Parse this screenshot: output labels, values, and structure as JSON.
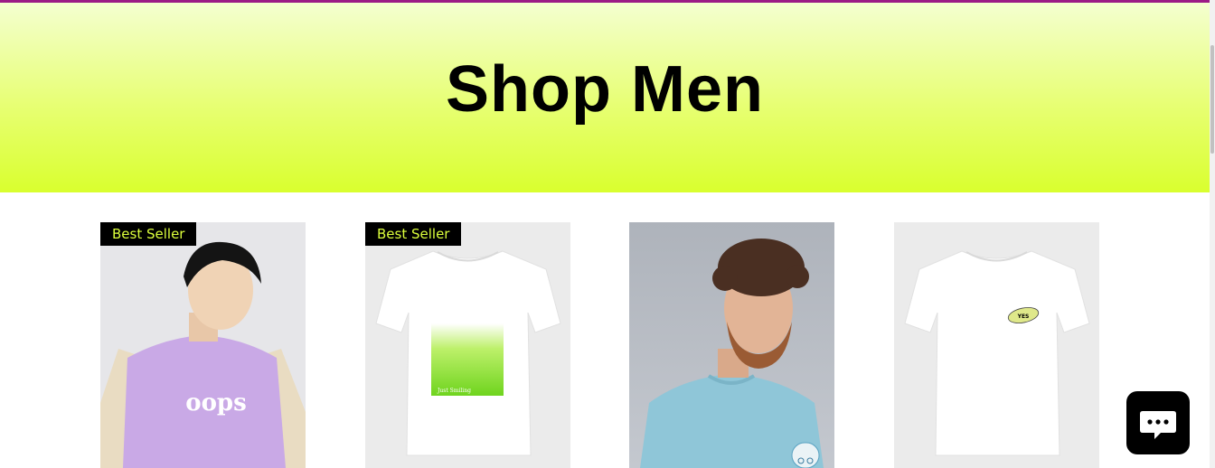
{
  "hero": {
    "title": "Shop Men"
  },
  "colors": {
    "accent_border": "#9c1a86",
    "hero_gradient": [
      "#f4ffd0",
      "#d9ff2e"
    ],
    "ribbon_text": "#dcff3c"
  },
  "products": [
    {
      "ribbon": "Best Seller",
      "image": "model in lavender oops t-shirt with beige jacket",
      "print": "oops"
    },
    {
      "ribbon": "Best Seller",
      "image": "white t-shirt with green gradient print",
      "print": "Just Smiling"
    },
    {
      "ribbon": "",
      "image": "model in light blue t-shirt with bicycle patch"
    },
    {
      "ribbon": "",
      "image": "white t-shirt with yellow YES oval badge",
      "print": "YES"
    }
  ],
  "chat": {
    "icon": "chat-bubble-icon"
  }
}
